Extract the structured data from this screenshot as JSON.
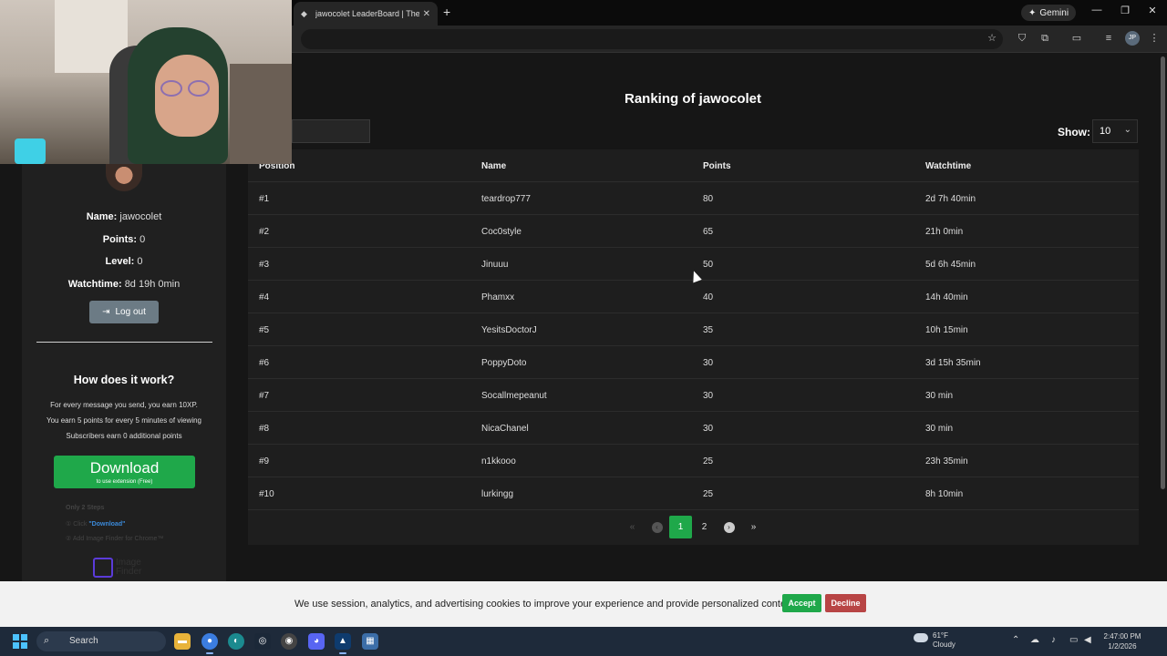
{
  "browser": {
    "tab_title": "jawocolet LeaderBoard | The be",
    "tab_close": "✕",
    "new_tab": "+",
    "gemini_label": "Gemini",
    "gemini_icon": "✦",
    "profile_initials": "JP",
    "window_controls": [
      "—",
      "❐",
      "✕"
    ]
  },
  "page": {
    "title": "Ranking of jawocolet",
    "show_label": "Show:",
    "show_value": "10"
  },
  "sidebar": {
    "name_label": "Name:",
    "name_value": "jawocolet",
    "points_label": "Points:",
    "points_value": "0",
    "level_label": "Level:",
    "level_value": "0",
    "watchtime_label": "Watchtime:",
    "watchtime_value": "8d 19h 0min",
    "logout_label": "Log out",
    "how_title": "How does it work?",
    "how_lines": [
      "For every message you send, you earn 10XP.",
      "You earn 5 points for every 5 minutes of viewing",
      "Subscribers earn 0 additional points"
    ]
  },
  "ad": {
    "download_big": "Download",
    "download_small": "to use extension (Free)",
    "steps_title": "Only 2 Steps",
    "step1_prefix": "① Click ",
    "step1_link": "\"Download\"",
    "step2": "② Add Image Finder for Chrome™",
    "logo_line1": "Image",
    "logo_line2": "Finder"
  },
  "table": {
    "headers": [
      "Position",
      "Name",
      "Points",
      "Watchtime"
    ],
    "rows": [
      [
        "#1",
        "teardrop777",
        "80",
        "2d 7h 40min"
      ],
      [
        "#2",
        "Coc0style",
        "65",
        "21h 0min"
      ],
      [
        "#3",
        "Jinuuu",
        "50",
        "5d 6h 45min"
      ],
      [
        "#4",
        "Phamxx",
        "40",
        "14h 40min"
      ],
      [
        "#5",
        "YesitsDoctorJ",
        "35",
        "10h 15min"
      ],
      [
        "#6",
        "PoppyDoto",
        "30",
        "3d 15h 35min"
      ],
      [
        "#7",
        "Socallmepeanut",
        "30",
        "30 min"
      ],
      [
        "#8",
        "NicaChanel",
        "30",
        "30 min"
      ],
      [
        "#9",
        "n1kkooo",
        "25",
        "23h 35min"
      ],
      [
        "#10",
        "lurkingg",
        "25",
        "8h 10min"
      ]
    ]
  },
  "pagination": {
    "first": "«",
    "prev": "‹",
    "pages": [
      "1",
      "2"
    ],
    "current": "1",
    "next": "›",
    "last": "»"
  },
  "cookie": {
    "text": "We use session, analytics, and advertising cookies to improve your experience and provide personalized content.",
    "accept": "Accept",
    "decline": "Decline"
  },
  "taskbar": {
    "search_label": "Search",
    "weather_temp": "61°F",
    "weather_desc": "Cloudy",
    "time": "2:47:00 PM",
    "date": "1/2/2026"
  },
  "colors": {
    "accent_green": "#1fa84a",
    "decline_red": "#b84545",
    "page_bg": "#161616"
  }
}
